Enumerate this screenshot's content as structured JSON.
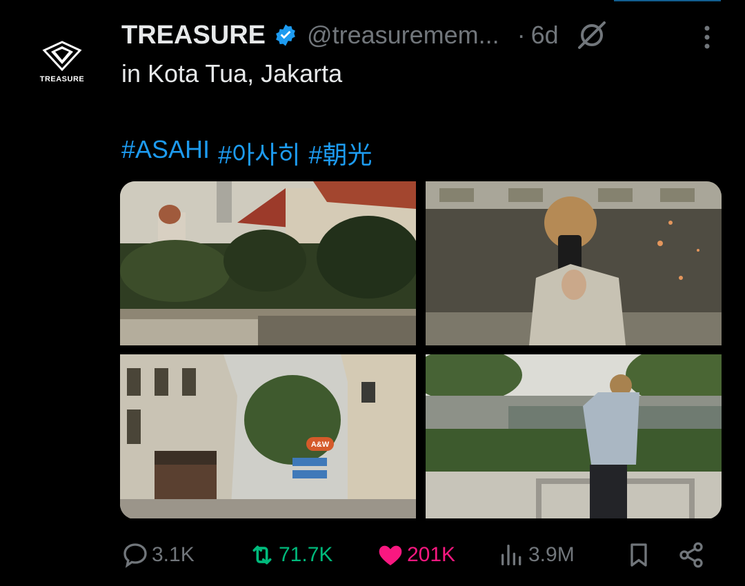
{
  "account": {
    "avatar_text": "TREASURE",
    "name": "TREASURE",
    "handle": "@treasuremem...",
    "separator": "·",
    "time": "6d"
  },
  "post": {
    "text": "in Kota Tua, Jakarta",
    "hashtags": [
      "#ASAHI",
      "#아사히",
      "#朝光"
    ]
  },
  "media": {
    "photos": [
      {
        "label": "colonial buildings and palm trees"
      },
      {
        "label": "mirror selfie"
      },
      {
        "label": "old town street"
      },
      {
        "label": "person with camera by canal"
      }
    ],
    "sign_text": "A&W"
  },
  "metrics": {
    "replies": "3.1K",
    "reposts": "71.7K",
    "likes": "201K",
    "views": "3.9M"
  },
  "colors": {
    "accent": "#1d9bf0",
    "repost": "#00ba7c",
    "like": "#f91880",
    "muted": "#71767b"
  },
  "icons": {
    "verified": "verified-badge-icon",
    "grok": "grok-icon",
    "more": "more-icon",
    "reply": "reply-icon",
    "repost": "repost-icon",
    "like": "heart-icon",
    "views": "views-icon",
    "bookmark": "bookmark-icon",
    "share": "share-icon"
  }
}
